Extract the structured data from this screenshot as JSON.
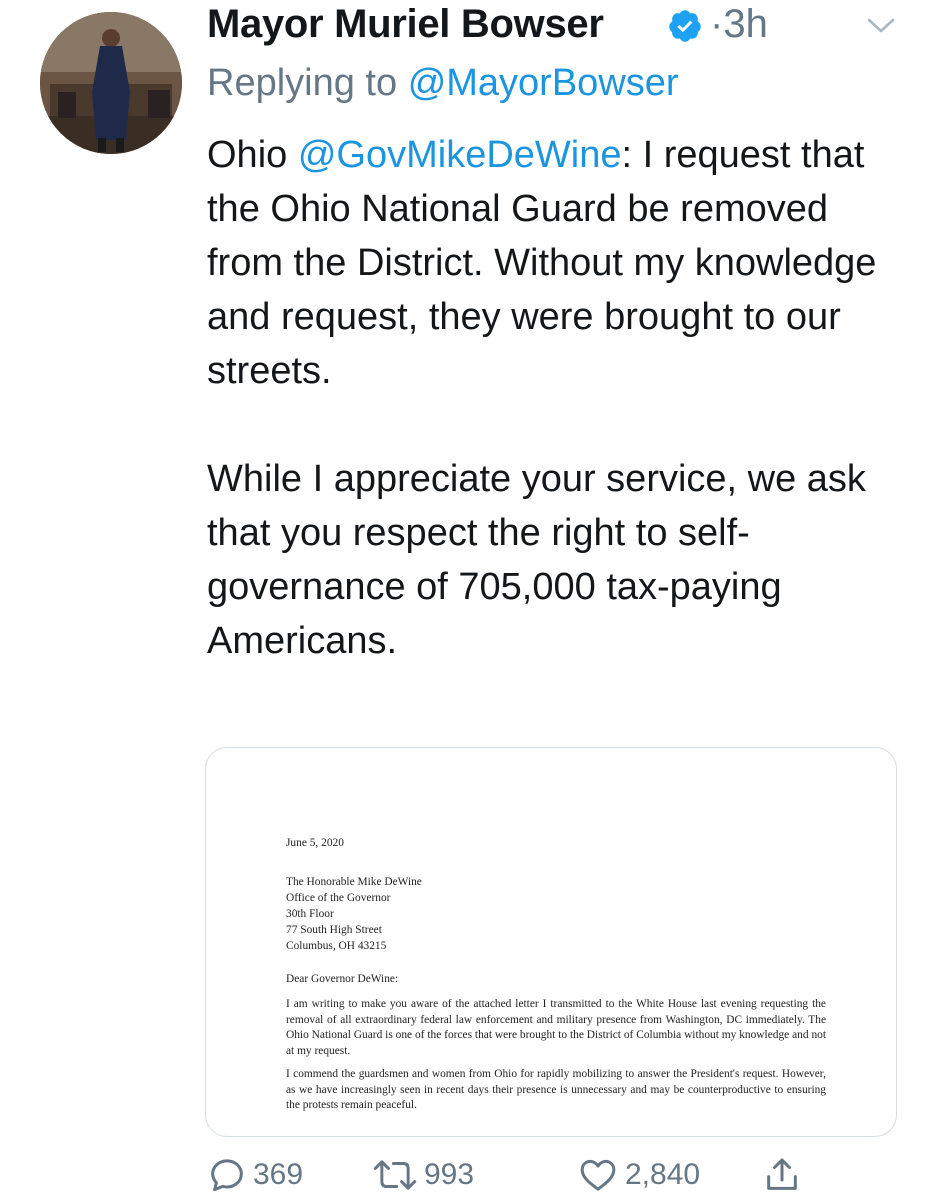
{
  "tweet": {
    "author_name": "Mayor Muriel Bowser",
    "time_separator": "·",
    "time": "3h",
    "replying_prefix": "Replying to",
    "replying_handle": "@MayorBowser",
    "text_intro": "Ohio ",
    "text_mention": "@GovMikeDeWine",
    "text_rest": ": I request that the Ohio National Guard be removed from the District. Without my knowledge and request, they were brought to our streets.",
    "text_para2": "While I appreciate your service, we ask that you respect the right to self-governance of 705,000 tax-paying Americans."
  },
  "letter": {
    "date": "June 5, 2020",
    "address": [
      "The Honorable Mike DeWine",
      "Office of the Governor",
      "30th Floor",
      "77 South High Street",
      "Columbus, OH 43215"
    ],
    "greeting": "Dear Governor DeWine:",
    "para1": "I am writing to make you aware of the attached letter I transmitted to the White House last evening requesting the removal of all extraordinary federal law enforcement and military presence from Washington, DC immediately. The Ohio National Guard is one of the forces that were brought to the District of Columbia without my knowledge and not at my request.",
    "para2": "I commend the guardsmen and women from Ohio for rapidly mobilizing to answer the President's request. However, as we have increasingly seen in recent days their presence is unnecessary and may be counterproductive to ensuring the protests remain peaceful."
  },
  "actions": {
    "replies": "369",
    "retweets": "993",
    "likes": "2,840"
  },
  "icons": {
    "verified": "verified-badge-icon",
    "menu": "chevron-down-icon",
    "reply": "reply-icon",
    "retweet": "retweet-icon",
    "like": "heart-icon",
    "share": "share-icon"
  },
  "colors": {
    "link": "#1b95e0",
    "muted": "#657786",
    "text": "#14171a",
    "verified": "#1da1f2"
  }
}
